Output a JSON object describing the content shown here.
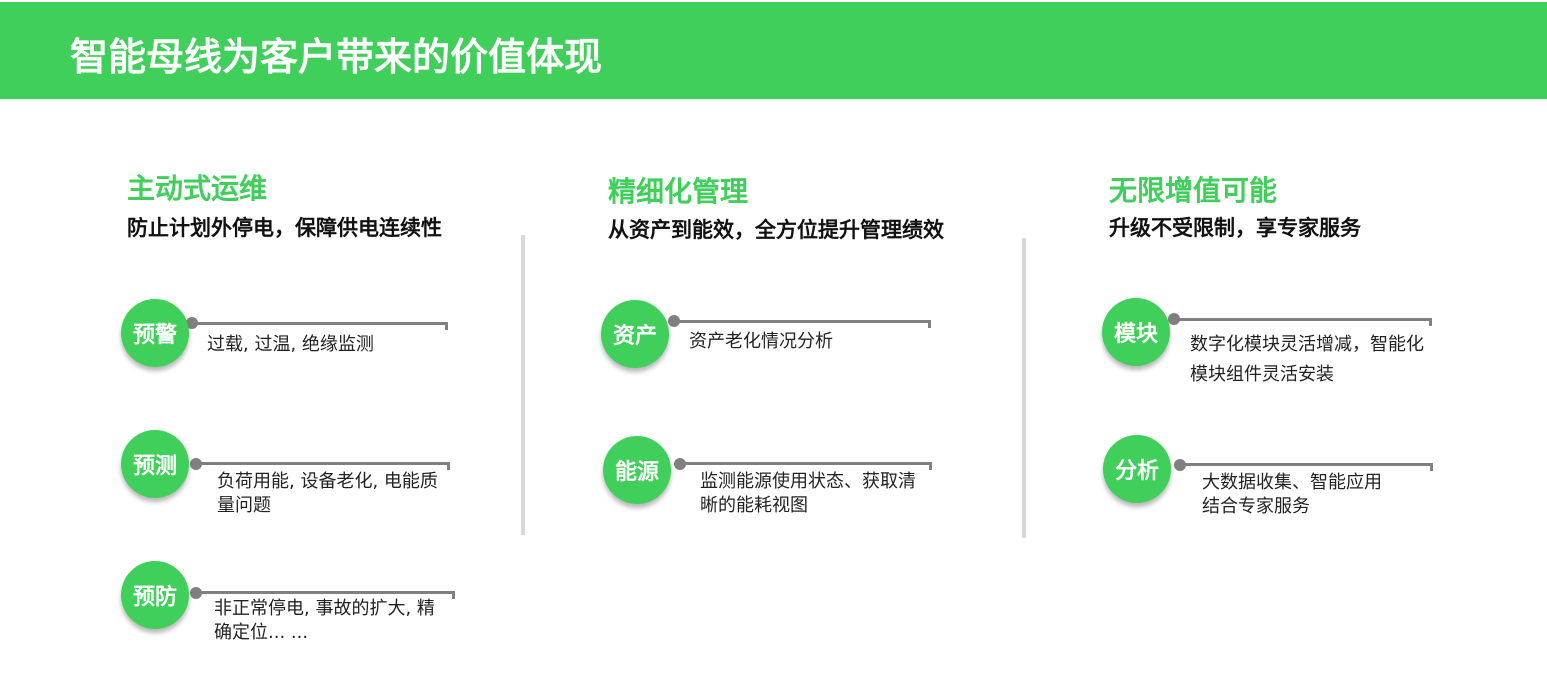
{
  "header": {
    "title": "智能母线为客户带来的价值体现"
  },
  "columns": [
    {
      "title": "主动式运维",
      "subtitle": "防止计划外停电，保障供电连续性",
      "items": [
        {
          "badge": "预警",
          "desc": "过载, 过温, 绝缘监测"
        },
        {
          "badge": "预测",
          "desc": "负荷用能, 设备老化, 电能质量问题"
        },
        {
          "badge": "预防",
          "desc": "非正常停电, 事故的扩大, 精确定位... ..."
        }
      ]
    },
    {
      "title": "精细化管理",
      "subtitle": "从资产到能效，全方位提升管理绩效",
      "items": [
        {
          "badge": "资产",
          "desc": "资产老化情况分析"
        },
        {
          "badge": "能源",
          "desc": "监测能源使用状态、获取清晰的能耗视图"
        }
      ]
    },
    {
      "title": "无限增值可能",
      "subtitle": "升级不受限制，享专家服务",
      "items": [
        {
          "badge": "模块",
          "desc": "数字化模块灵活增减，智能化模块组件灵活安装"
        },
        {
          "badge": "分析",
          "desc": "大数据收集、智能应用结合专家服务"
        }
      ]
    }
  ],
  "colors": {
    "accent": "#3fcf5a",
    "connector": "#808080",
    "divider": "#d9d9d9"
  }
}
